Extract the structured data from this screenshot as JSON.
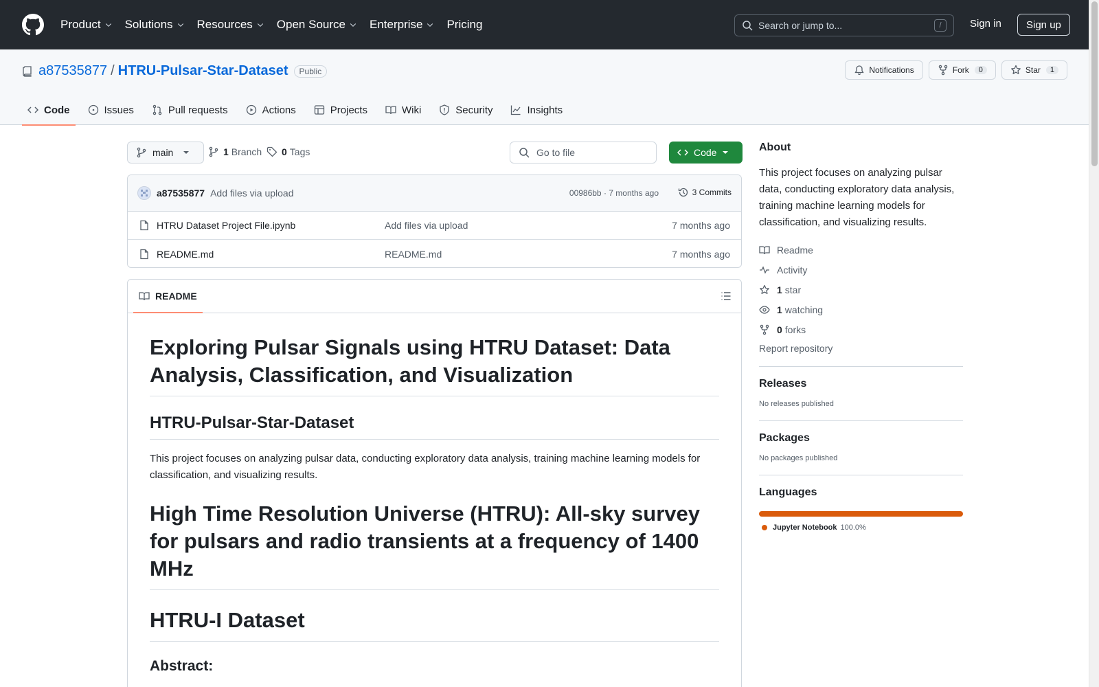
{
  "header": {
    "nav": [
      {
        "label": "Product",
        "has_caret": true
      },
      {
        "label": "Solutions",
        "has_caret": true
      },
      {
        "label": "Resources",
        "has_caret": true
      },
      {
        "label": "Open Source",
        "has_caret": true
      },
      {
        "label": "Enterprise",
        "has_caret": true
      },
      {
        "label": "Pricing",
        "has_caret": false
      }
    ],
    "search_placeholder": "Search or jump to...",
    "search_shortcut": "/",
    "sign_in": "Sign in",
    "sign_up": "Sign up"
  },
  "repo": {
    "owner": "a87535877",
    "separator": "/",
    "name": "HTRU-Pulsar-Star-Dataset",
    "visibility": "Public",
    "notifications_label": "Notifications",
    "fork_label": "Fork",
    "fork_count": "0",
    "star_label": "Star",
    "star_count": "1",
    "tabs": [
      {
        "label": "Code",
        "icon": "code-icon",
        "active": true
      },
      {
        "label": "Issues",
        "icon": "issue-icon"
      },
      {
        "label": "Pull requests",
        "icon": "pull-request-icon"
      },
      {
        "label": "Actions",
        "icon": "play-icon"
      },
      {
        "label": "Projects",
        "icon": "table-icon"
      },
      {
        "label": "Wiki",
        "icon": "book-icon"
      },
      {
        "label": "Security",
        "icon": "shield-icon"
      },
      {
        "label": "Insights",
        "icon": "graph-icon"
      }
    ]
  },
  "toolbar": {
    "branch": "main",
    "branch_count": "1",
    "branch_label": "Branch",
    "tag_count": "0",
    "tag_label": "Tags",
    "goto_placeholder": "Go to file",
    "code_button": "Code"
  },
  "commit": {
    "author": "a87535877",
    "message": "Add files via upload",
    "hash_time": "00986bb · 7 months ago",
    "commits_label": "3 Commits"
  },
  "files": [
    {
      "name": "HTRU Dataset Project File.ipynb",
      "commit": "Add files via upload",
      "time": "7 months ago"
    },
    {
      "name": "README.md",
      "commit": "README.md",
      "time": "7 months ago"
    }
  ],
  "readme": {
    "tab_label": "README",
    "h1": "Exploring Pulsar Signals using HTRU Dataset: Data Analysis, Classification, and Visualization",
    "h2": "HTRU-Pulsar-Star-Dataset",
    "paragraph": "This project focuses on analyzing pulsar data, conducting exploratory data analysis, training machine learning models for classification, and visualizing results.",
    "h1_2": "High Time Resolution Universe (HTRU): All-sky survey for pulsars and radio transients at a frequency of 1400 MHz",
    "h1_3": "HTRU-I Dataset",
    "h3": "Abstract:"
  },
  "about": {
    "title": "About",
    "description": "This project focuses on analyzing pulsar data, conducting exploratory data analysis, training machine learning models for classification, and visualizing results.",
    "readme": "Readme",
    "activity": "Activity",
    "stars_count": "1",
    "stars_label": "star",
    "watching_count": "1",
    "watching_label": "watching",
    "forks_count": "0",
    "forks_label": "forks",
    "report": "Report repository"
  },
  "releases": {
    "title": "Releases",
    "empty": "No releases published"
  },
  "packages": {
    "title": "Packages",
    "empty": "No packages published"
  },
  "languages": {
    "title": "Languages",
    "items": [
      {
        "name": "Jupyter Notebook",
        "percent": "100.0%",
        "color": "#DA5B0B"
      }
    ]
  }
}
